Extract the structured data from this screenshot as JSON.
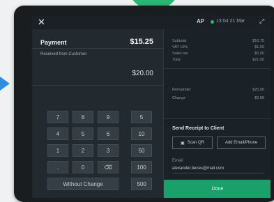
{
  "colors": {
    "accent": "#1aa06a",
    "arrow": "#2b8ee0",
    "screen_bg": "#222a30"
  },
  "status": {
    "close_icon": "close-icon",
    "user_initials": "AP",
    "time": "13:04 21 Mar",
    "expand_icon": "expand-icon"
  },
  "payment": {
    "label": "Payment",
    "amount": "$15.25",
    "received_label": "Received from Customer",
    "received_amount": "$20.00"
  },
  "keypad": {
    "rows": [
      [
        "7",
        "8",
        "9",
        "5"
      ],
      [
        "4",
        "5",
        "6",
        "10"
      ],
      [
        "1",
        "2",
        "3",
        "50"
      ],
      [
        ".",
        "0",
        "⌫",
        "100"
      ]
    ],
    "without_change": "Without Change",
    "last_quick": "500"
  },
  "summary": {
    "rows": [
      {
        "label": "Subtotal",
        "value": "$16.75"
      },
      {
        "label": "VAT 10%",
        "value": "$1.50"
      },
      {
        "label": "Sales tax",
        "value": "$5.00"
      },
      {
        "label": "Total",
        "value": "$21.00"
      }
    ],
    "rows2": [
      {
        "label": "Remainder",
        "value": "$25.00"
      },
      {
        "label": "Change",
        "value": "$3.68"
      }
    ]
  },
  "receipt": {
    "title": "Send Receipt to Client",
    "scan_label": "Scan QR",
    "email_button": "Add Email/Phone",
    "email_label": "Email",
    "email_value": "alexander.benes@mail.com",
    "done_label": "Done"
  }
}
